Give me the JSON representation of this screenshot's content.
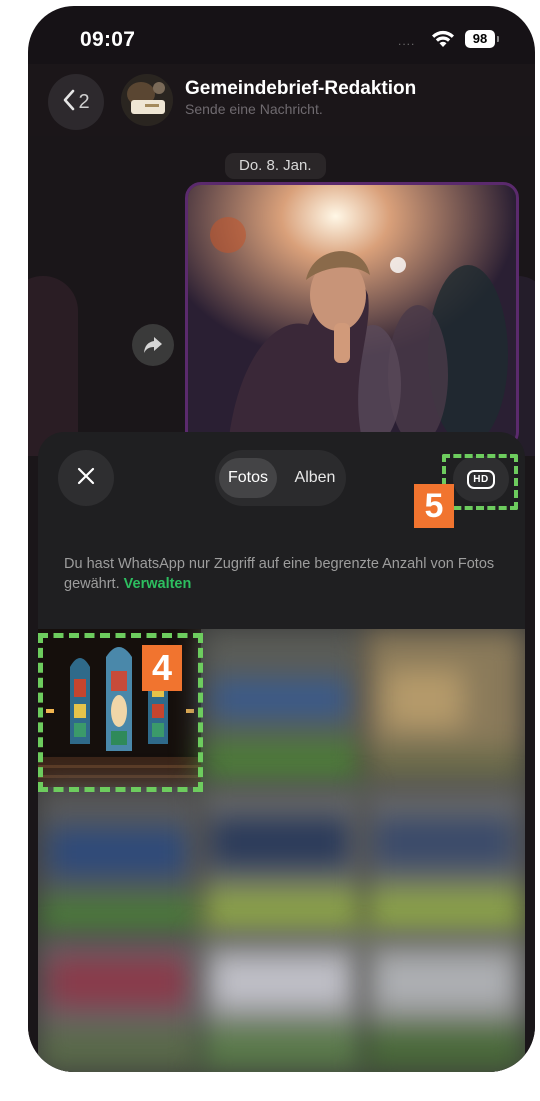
{
  "status_bar": {
    "time": "09:07",
    "signal": "....",
    "battery": "98"
  },
  "chat": {
    "back_count": "2",
    "title": "Gemeindebrief-Redaktion",
    "subtitle": "Sende eine Nachricht.",
    "date_label": "Do. 8. Jan."
  },
  "picker": {
    "tabs": [
      "Fotos",
      "Alben"
    ],
    "selected_tab": "Fotos",
    "hd_label": "HD",
    "info_text": "Du hast WhatsApp nur Zugriff auf eine begrenzte Anzahl von Fotos gewährt.",
    "manage_link": "Verwalten"
  },
  "annotations": {
    "step_hd": "5",
    "step_photo": "4"
  },
  "colors": {
    "highlight": "#6dcc5e",
    "step_badge": "#f1742f",
    "manage_link": "#2dbe5f",
    "bubble_border": "#5b2a6d"
  },
  "icons": [
    "wifi-icon",
    "battery-icon",
    "chevron-left-icon",
    "share-forward-icon",
    "close-icon"
  ]
}
